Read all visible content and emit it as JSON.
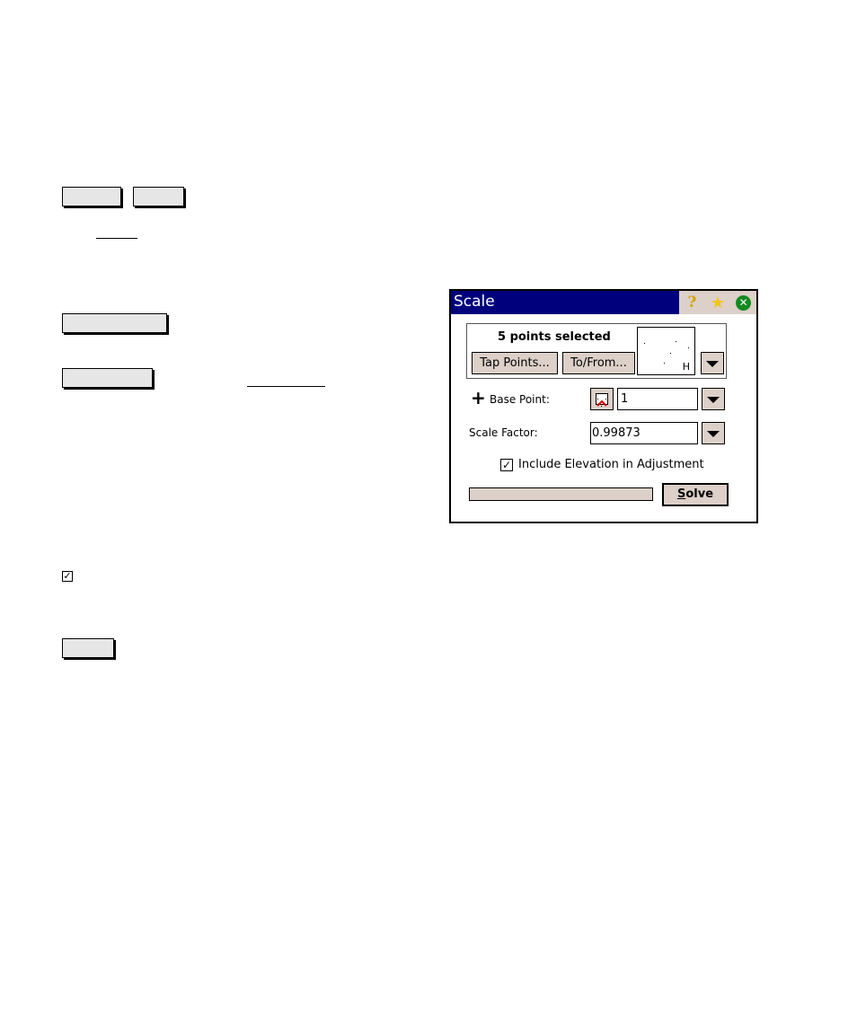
{
  "document": {
    "checkbox_mark": "✓"
  },
  "window": {
    "title": "Scale",
    "title_icons": [
      "help-icon",
      "star-icon",
      "close-icon"
    ],
    "help_glyph": "?",
    "star_glyph": "★",
    "close_glyph": "✕",
    "selection": {
      "text": "5 points selected",
      "tap_points_label": "Tap Points...",
      "to_from_label": "To/From...",
      "preview_label": "H"
    },
    "base_point": {
      "plus_glyph": "+",
      "label": "Base Point:",
      "value": "1"
    },
    "scale_factor": {
      "label": "Scale Factor:",
      "value": "0.99873"
    },
    "include_elevation": {
      "checked": true,
      "mark": "✓",
      "label": "Include Elevation in Adjustment"
    },
    "progress": 0,
    "solve": {
      "accel": "S",
      "rest": "olve"
    },
    "colors": {
      "titlebar": "#00007c",
      "button_face": "#dcd0c8",
      "close_green": "#138a1f"
    }
  }
}
